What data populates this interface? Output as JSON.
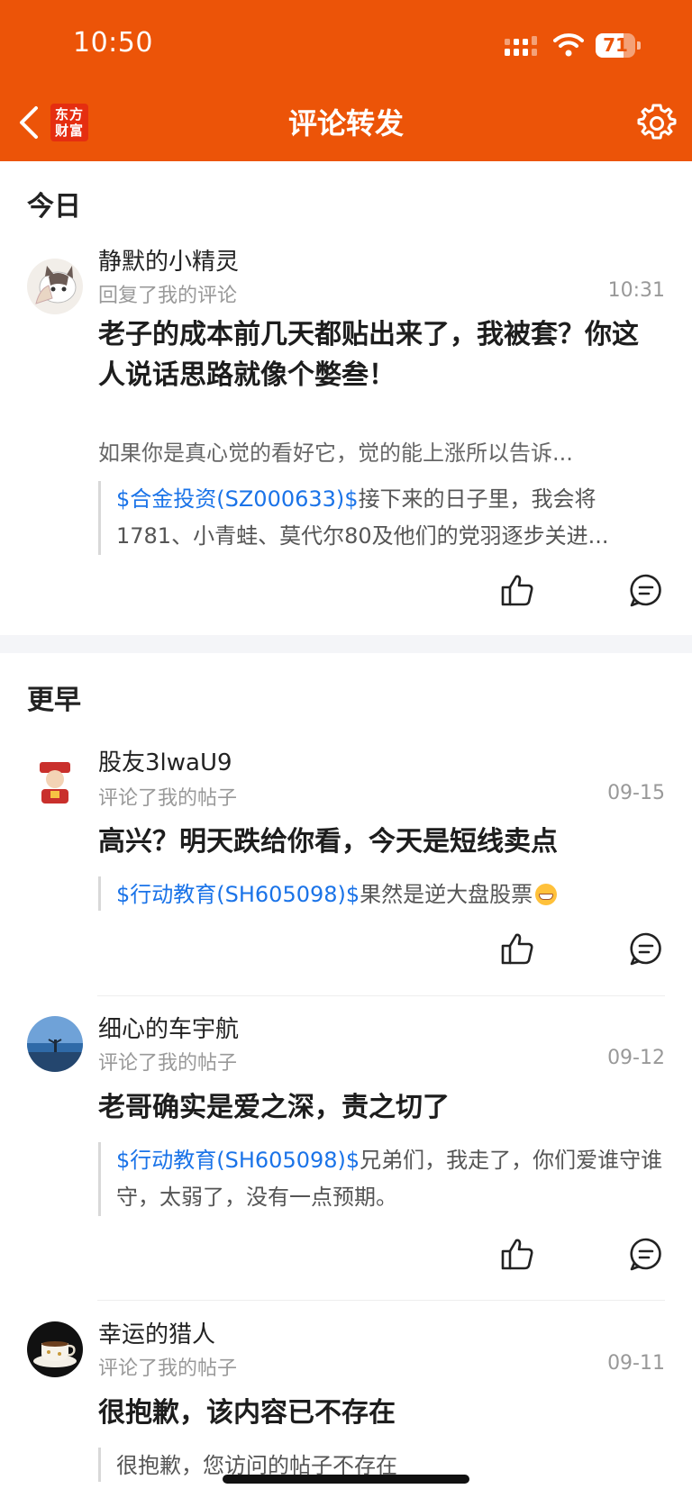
{
  "status": {
    "time": "10:50",
    "battery": "71",
    "battery_level": 0.71
  },
  "header": {
    "title": "评论转发",
    "logo_text_1": "东方",
    "logo_text_2": "财富"
  },
  "sections": {
    "today": "今日",
    "earlier": "更早"
  },
  "items": [
    {
      "user": "静默的小精灵",
      "action": "回复了我的评论",
      "time": "10:31",
      "content": "老子的成本前几天都贴出来了，我被套？你这人说话思路就像个嫳叁！",
      "summary": "如果你是真心觉的看好它，觉的能上涨所以告诉...",
      "quote_tag": "$合金投资(SZ000633)$",
      "quote_text": "接下来的日子里，我会将1781、小青蛙、莫代尔80及他们的党羽逐步关进..."
    },
    {
      "user": "股友3lwaU9",
      "action": "评论了我的帖子",
      "time": "09-15",
      "content": "高兴？明天跌给你看，今天是短线卖点",
      "quote_tag": "$行动教育(SH605098)$",
      "quote_text": "果然是逆大盘股票"
    },
    {
      "user": "细心的车宇航",
      "action": "评论了我的帖子",
      "time": "09-12",
      "content": "老哥确实是爱之深，责之切了",
      "quote_tag": "$行动教育(SH605098)$",
      "quote_text": "兄弟们，我走了，你们爱谁守谁守，太弱了，没有一点预期。"
    },
    {
      "user": "幸运的猎人",
      "action": "评论了我的帖子",
      "time": "09-11",
      "content": "很抱歉，该内容已不存在",
      "quote_text": "很抱歉，您访问的帖子不存在"
    }
  ],
  "icons": {
    "like": "thumbs-up-icon",
    "reply": "comment-icon",
    "settings": "gear-icon",
    "back": "chevron-left-icon"
  },
  "colors": {
    "brand": "#ec5408",
    "link": "#1a73e8"
  }
}
